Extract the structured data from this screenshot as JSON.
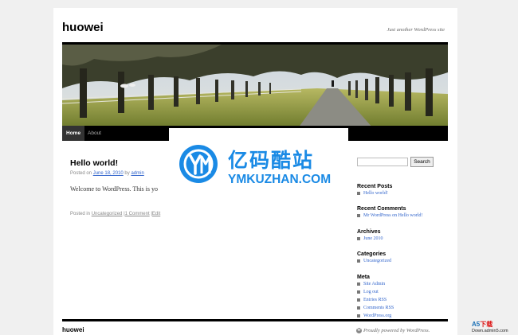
{
  "site": {
    "title": "huowei",
    "description": "Just another WordPress site"
  },
  "nav": {
    "items": [
      "Home",
      "About"
    ]
  },
  "post": {
    "title": "Hello world!",
    "meta": {
      "posted_on": "Posted on",
      "date": "June 18, 2010",
      "by": "by",
      "author": "admin"
    },
    "content": "Welcome to WordPress. This is yo",
    "utility": {
      "posted_in": "Posted in",
      "category": "Uncategorized",
      "sep": "|",
      "comments": "1 Comment",
      "edit": "Edit"
    }
  },
  "watermark": {
    "cn": "亿码酷站",
    "en": "YMKUZHAN.COM"
  },
  "sidebar": {
    "search_button": "Search",
    "search_value": "",
    "recent_posts": {
      "title": "Recent Posts",
      "items": [
        "Hello world!"
      ]
    },
    "recent_comments": {
      "title": "Recent Comments",
      "items": [
        "Mr WordPress on Hello world!"
      ]
    },
    "archives": {
      "title": "Archives",
      "items": [
        "June 2010"
      ]
    },
    "categories": {
      "title": "Categories",
      "items": [
        "Uncategorized"
      ]
    },
    "meta": {
      "title": "Meta",
      "items": [
        "Site Admin",
        "Log out",
        "Entries RSS",
        "Comments RSS",
        "WordPress.org"
      ]
    }
  },
  "footer": {
    "title": "huowei",
    "powered": "Proudly powered by WordPress."
  },
  "corner_mark": {
    "main": "A5",
    "accent": "下载",
    "sub": "Down.admin5.com"
  },
  "colors": {
    "accent": "#1a8ae5",
    "link": "#3366cc",
    "nav_bg": "#000000"
  }
}
